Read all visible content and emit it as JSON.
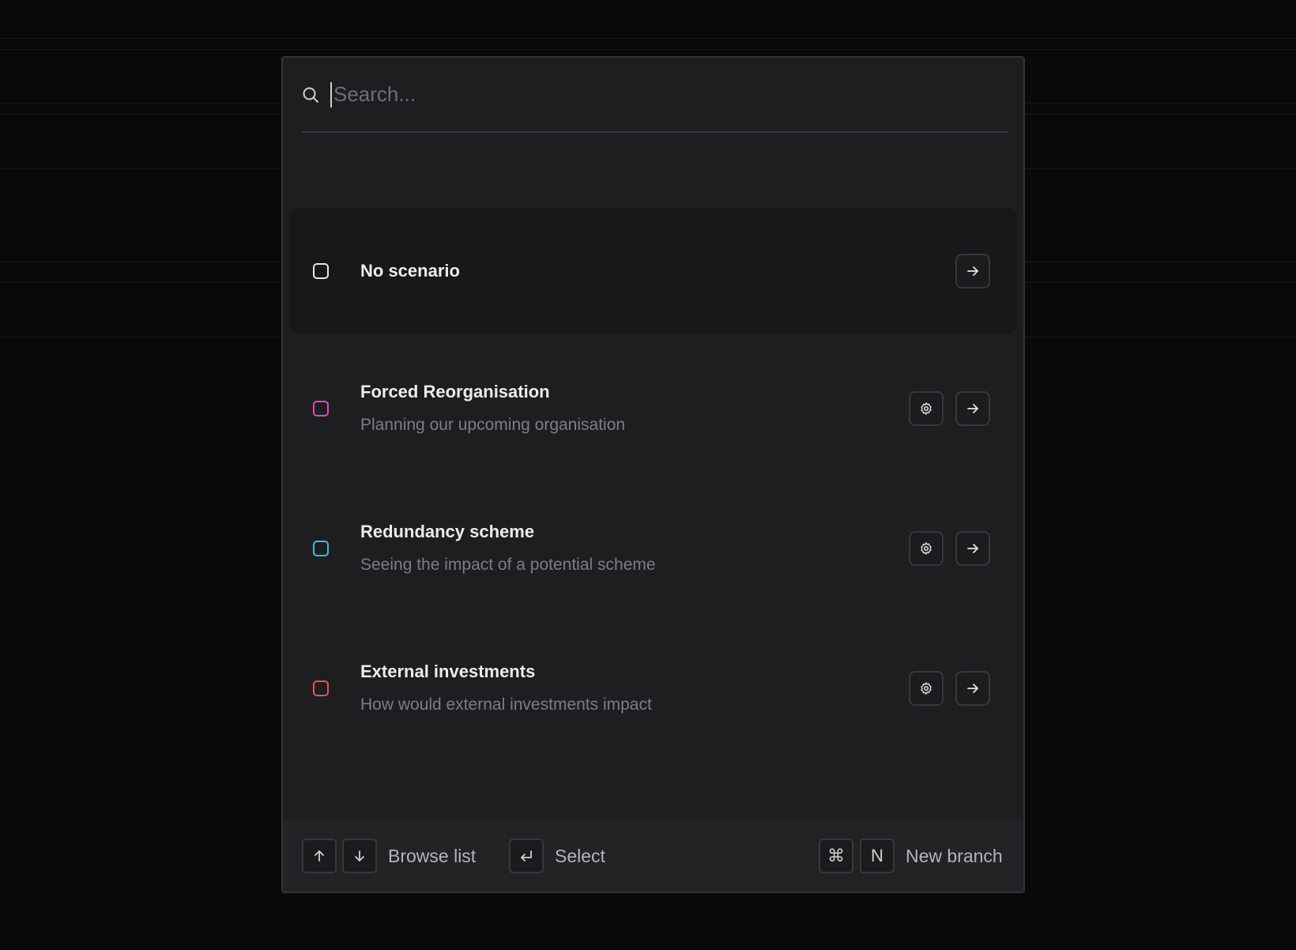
{
  "search": {
    "placeholder": "Search...",
    "value": ""
  },
  "scenarios": [
    {
      "title": "No scenario",
      "description": "",
      "swatch_color": "#e6e6e8",
      "has_settings": false,
      "active": true
    },
    {
      "title": "Forced Reorganisation",
      "description": "Planning our upcoming organisation",
      "swatch_color": "#d94fb5",
      "has_settings": true,
      "active": false
    },
    {
      "title": "Redundancy scheme",
      "description": "Seeing the impact of a potential scheme",
      "swatch_color": "#4fb6d9",
      "has_settings": true,
      "active": false
    },
    {
      "title": "External investments",
      "description": "How would external investments impact",
      "swatch_color": "#e0564f",
      "has_settings": true,
      "active": false
    }
  ],
  "footer": {
    "browse_label": "Browse list",
    "select_label": "Select",
    "new_branch_label": "New branch",
    "new_branch_key": "N",
    "cmd_key": "⌘"
  },
  "icons": {
    "search": "search-icon",
    "settings": "gear-icon",
    "open": "arrow-right-icon",
    "up": "arrow-up-icon",
    "down": "arrow-down-icon",
    "enter": "enter-icon"
  }
}
